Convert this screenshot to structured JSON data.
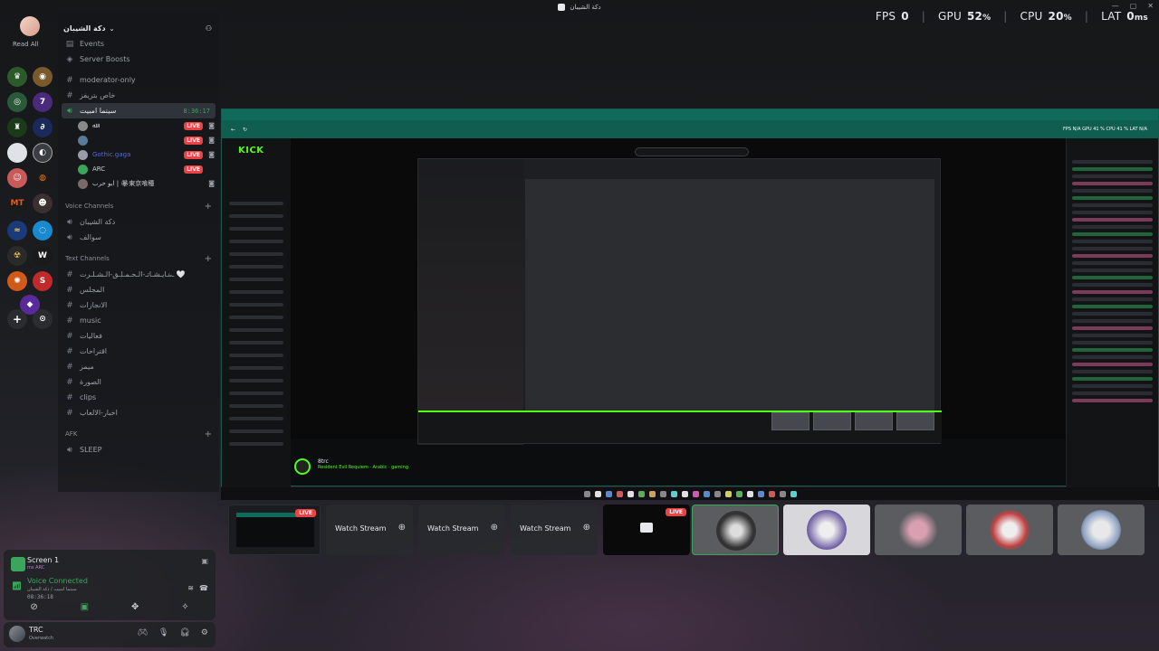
{
  "window": {
    "title": "دكة الشيبان"
  },
  "perf": {
    "fps_label": "FPS",
    "fps": "0",
    "gpu_label": "GPU",
    "gpu": "52",
    "cpu_label": "CPU",
    "cpu": "20",
    "lat_label": "LAT",
    "lat": "0",
    "pct": "%",
    "ms": "ms"
  },
  "rail": {
    "read_all": "Read All"
  },
  "guild": {
    "name": "دكة الشيبان"
  },
  "sidebar": {
    "top": [
      {
        "icon": "▤",
        "label": "Events"
      },
      {
        "icon": "◈",
        "label": "Server Boosts"
      }
    ],
    "channels1": [
      {
        "label": "moderator-only"
      },
      {
        "label": "خاص بتريفز"
      }
    ],
    "active_voice": {
      "label": "سينما امبيت",
      "time": "8:36:17"
    },
    "voice_users": [
      {
        "name": "ﷲ",
        "live": "LIVE"
      },
      {
        "name": "",
        "live": "LIVE"
      },
      {
        "name": "Gothic.gaga",
        "live": "LIVE"
      },
      {
        "name": "ARC",
        "live": "LIVE"
      },
      {
        "name": "ابو حرب | 🏵東京喰種",
        "live": ""
      }
    ],
    "voice_category": "Voice Channels",
    "voice_channels": [
      {
        "label": "دكة الشيبان"
      },
      {
        "label": "سوالف"
      }
    ],
    "text_category": "Text Channels",
    "text_channels": [
      {
        "label": "ـ᥀ـايـشـاتـ-الـحـمـلـق-الـشـلـرت 🤍"
      },
      {
        "label": "المجلس"
      },
      {
        "label": "الانجازات"
      },
      {
        "label": "music"
      },
      {
        "label": "فعاليات"
      },
      {
        "label": "اقتراحات"
      },
      {
        "label": "ميمز"
      },
      {
        "label": "الصورة"
      },
      {
        "label": "clips"
      },
      {
        "label": "اخبار-الالعاب"
      }
    ],
    "afk_category": "AFK",
    "afk_channels": [
      {
        "label": "SLEEP"
      }
    ]
  },
  "voice_panel": {
    "stream_title": "Screen 1",
    "stream_sub": "ms ARC",
    "connected": "Voice Connected",
    "channel": "سينما امبيت / دكة الشيبان",
    "time": "08:36:18"
  },
  "user": {
    "name": "TRC",
    "status": "Overwatch"
  },
  "video": {
    "kick_logo": "KICK",
    "streamer": "8trc",
    "tags": "Resident Evil Requiem · Arabic · gaming",
    "inner_perf": "FPS N/A   GPU 41 %   CPU 41 %   LAT N/A"
  },
  "tiles": {
    "live": "LIVE",
    "watch": [
      "Watch Stream",
      "Watch Stream",
      "Watch Stream"
    ]
  }
}
